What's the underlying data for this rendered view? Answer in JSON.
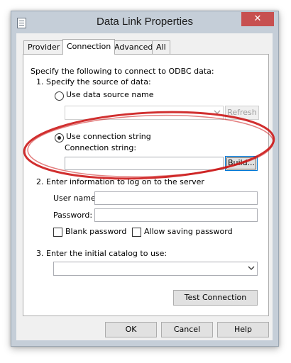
{
  "window": {
    "title": "Data Link Properties",
    "close_glyph": "✕"
  },
  "tabs": [
    {
      "label": "Provider"
    },
    {
      "label": "Connection"
    },
    {
      "label": "Advanced"
    },
    {
      "label": "All"
    }
  ],
  "connection": {
    "intro": "Specify the following to connect to ODBC data:",
    "step1": "1. Specify the source of data:",
    "use_dsn_label": "Use data source name",
    "use_dsn_selected": false,
    "dsn_value": "",
    "refresh_label": "Refresh",
    "use_conn_string_label": "Use connection string",
    "use_conn_string_selected": true,
    "conn_string_label": "Connection string:",
    "conn_string_value": "",
    "build_label": "Build...",
    "step2": "2. Enter information to log on to the server",
    "username_label": "User name:",
    "username_value": "",
    "password_label": "Password:",
    "password_value": "",
    "blank_password_label": "Blank password",
    "blank_password_checked": false,
    "allow_saving_label": "Allow saving password",
    "allow_saving_checked": false,
    "step3": "3. Enter the initial catalog to use:",
    "catalog_value": "",
    "test_connection_label": "Test Connection"
  },
  "footer": {
    "ok_label": "OK",
    "cancel_label": "Cancel",
    "help_label": "Help"
  },
  "annotation": {
    "color": "#cc1818",
    "shape": "ellipse-highlight"
  }
}
